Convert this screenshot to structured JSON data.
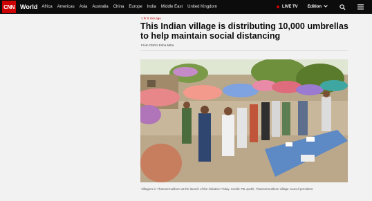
{
  "nav": {
    "logo_text": "CNN",
    "section": "World",
    "links": [
      "Africa",
      "Americas",
      "Asia",
      "Australia",
      "China",
      "Europe",
      "India",
      "Middle East",
      "United Kingdom"
    ],
    "live_label": "LIVE TV",
    "edition_label": "Edition",
    "icons": [
      "search-icon",
      "menu-icon"
    ]
  },
  "article": {
    "timestamp": "1 hr 5 min ago",
    "headline": "This Indian village is distributing 10,000 umbrellas to help maintain social distancing",
    "byline": "From CNN's Esha Mitra",
    "caption": "Villagers in Thannermukkom at the launch of the initiative Friday. Credit: PB Jyothi, Thannermukkom village council president"
  },
  "colors": {
    "brand_red": "#cc0000",
    "nav_bg": "#0c0c0c",
    "page_bg": "#f2f2f2"
  }
}
